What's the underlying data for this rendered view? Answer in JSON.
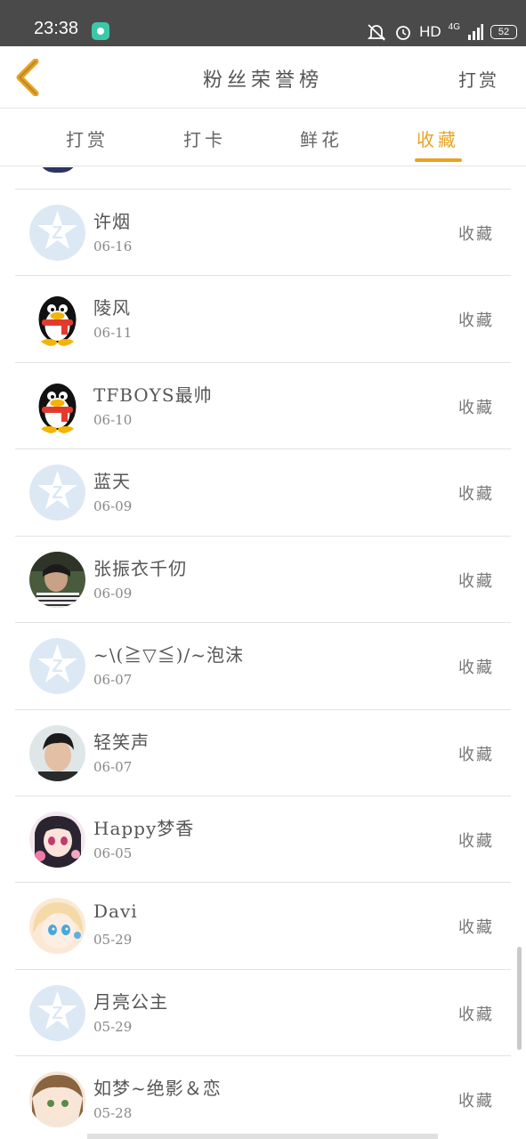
{
  "status_bar": {
    "time": "23:38",
    "network_type": "HD",
    "network_gen": "4G",
    "battery": "52",
    "icons": [
      "notification-app-icon",
      "mute-icon",
      "alarm-icon",
      "signal-icon",
      "battery-icon"
    ]
  },
  "header": {
    "back_icon": "chevron-left-icon",
    "title": "粉丝荣誉榜",
    "action_label": "打赏"
  },
  "tabs": [
    {
      "label": "打赏",
      "active": false
    },
    {
      "label": "打卡",
      "active": false
    },
    {
      "label": "鲜花",
      "active": false
    },
    {
      "label": "收藏",
      "active": true
    }
  ],
  "colors": {
    "accent": "#e8a320",
    "status_bar": "#4a4a4a",
    "divider": "#e2e2e2",
    "default_avatar": "#dce8f4"
  },
  "list": [
    {
      "name": "许烟",
      "date": "06-16",
      "action": "收藏",
      "avatar": "default-avatar-icon"
    },
    {
      "name": "陵风",
      "date": "06-11",
      "action": "收藏",
      "avatar": "penguin-avatar-icon"
    },
    {
      "name": "TFBOYS最帅",
      "date": "06-10",
      "action": "收藏",
      "avatar": "penguin-avatar-icon"
    },
    {
      "name": "蓝天",
      "date": "06-09",
      "action": "收藏",
      "avatar": "default-avatar-icon"
    },
    {
      "name": "张振衣千仞",
      "date": "06-09",
      "action": "收藏",
      "avatar": "photo-avatar"
    },
    {
      "name": "~\\(≧▽≦)/~泡沫",
      "date": "06-07",
      "action": "收藏",
      "avatar": "default-avatar-icon"
    },
    {
      "name": "轻笑声",
      "date": "06-07",
      "action": "收藏",
      "avatar": "photo-avatar"
    },
    {
      "name": "Happy梦香",
      "date": "06-05",
      "action": "收藏",
      "avatar": "anime-avatar"
    },
    {
      "name": "Davi",
      "date": "05-29",
      "action": "收藏",
      "avatar": "anime-avatar"
    },
    {
      "name": "月亮公主",
      "date": "05-29",
      "action": "收藏",
      "avatar": "default-avatar-icon"
    },
    {
      "name": "如梦~绝影＆恋",
      "date": "05-28",
      "action": "收藏",
      "avatar": "anime-avatar"
    }
  ]
}
